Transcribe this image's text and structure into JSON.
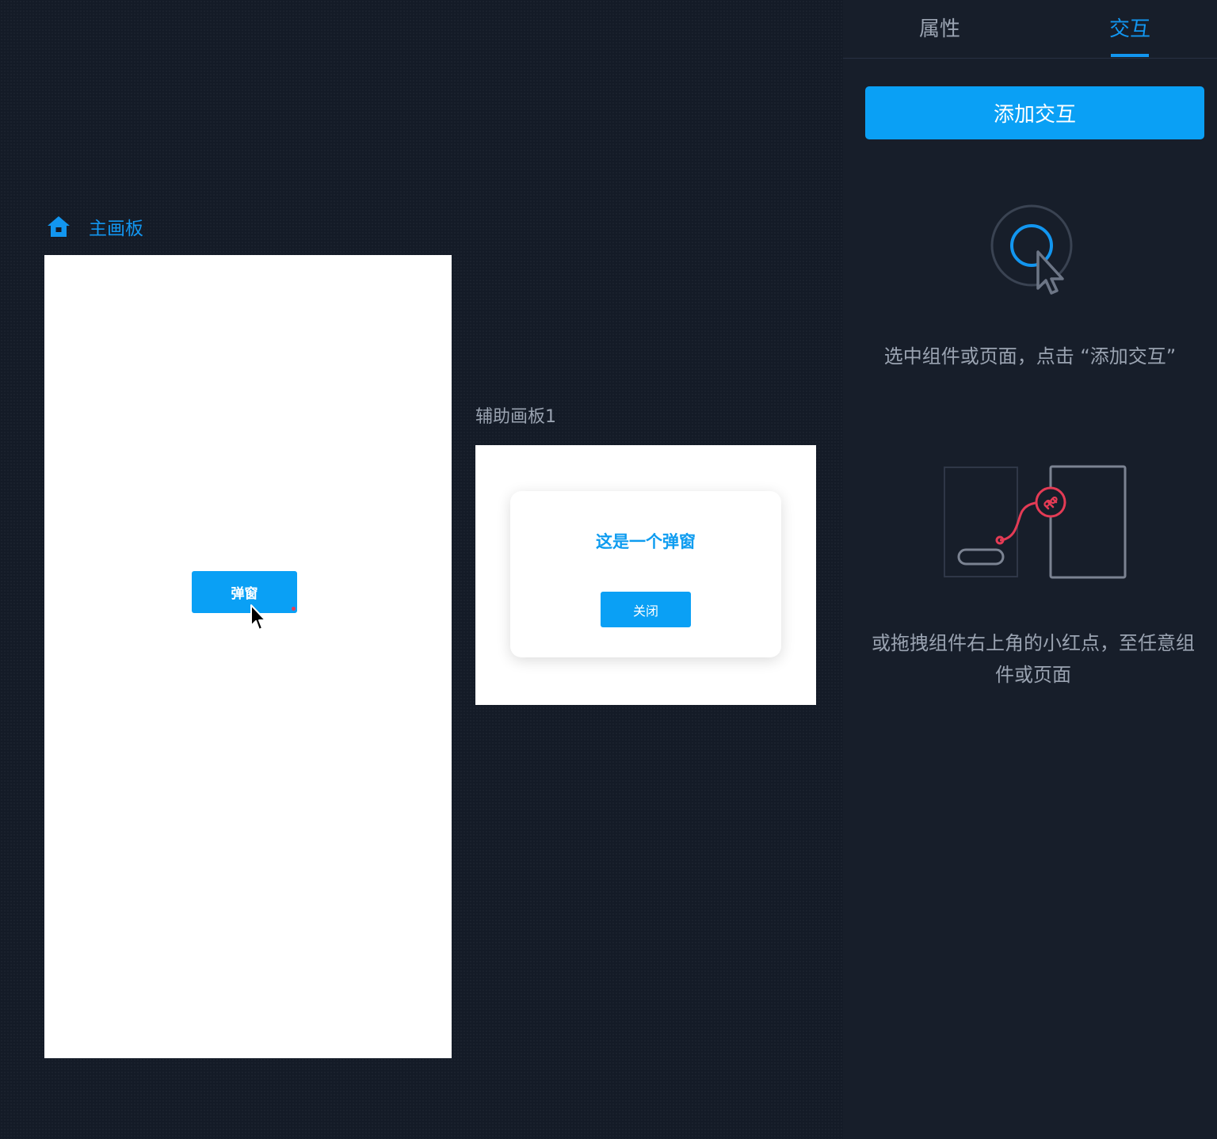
{
  "canvas": {
    "main_board": {
      "title": "主画板",
      "icon": "home-icon",
      "button_label": "弹窗"
    },
    "aux_board": {
      "title": "辅助画板1",
      "dialog": {
        "title": "这是一个弹窗",
        "close_label": "关闭"
      }
    }
  },
  "panel": {
    "tabs": [
      {
        "label": "属性",
        "active": false
      },
      {
        "label": "交互",
        "active": true
      }
    ],
    "add_button": "添加交互",
    "hint_select": "选中组件或页面，点击 “添加交互”",
    "hint_drag": "或拖拽组件右上角的小红点，至任意组件或页面"
  },
  "colors": {
    "accent": "#0aa0f5",
    "link_red": "#e43b55",
    "background": "#141b27",
    "panel_bg": "#171e2a",
    "muted_text": "#9aa3b1"
  }
}
